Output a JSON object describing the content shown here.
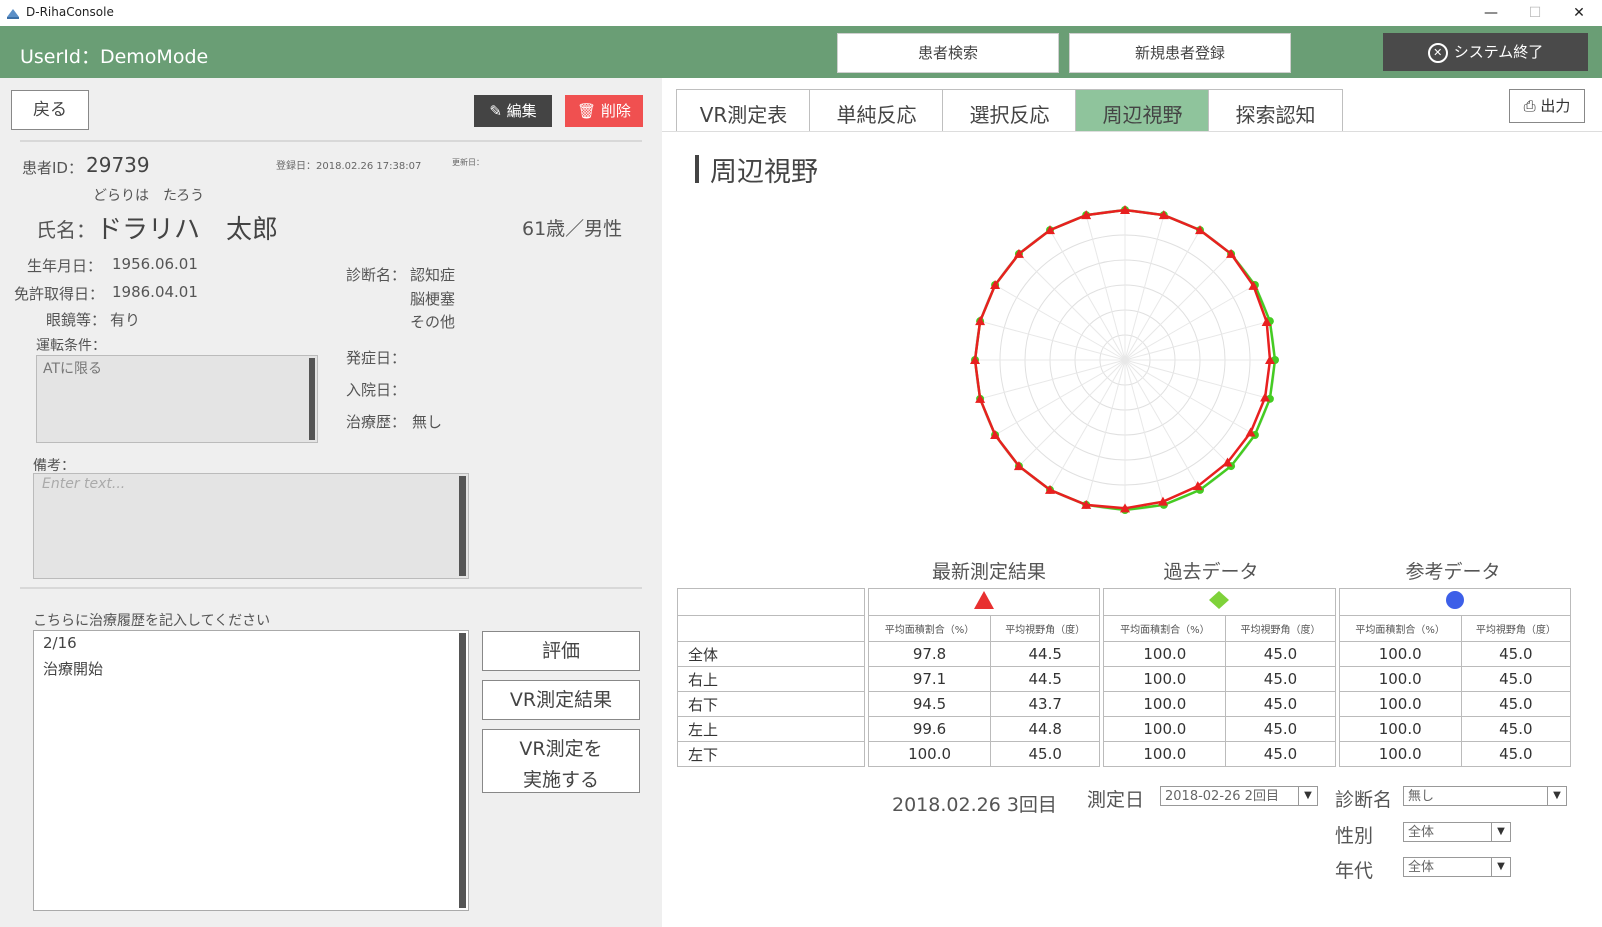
{
  "window": {
    "title": "D-RihaConsole",
    "minimize": "—",
    "maximize": "☐",
    "close": "✕"
  },
  "header": {
    "user_id": "UserId：DemoMode",
    "patient_search": "患者検索",
    "new_patient": "新規患者登録",
    "exit": "システム終了"
  },
  "left": {
    "back": "戻る",
    "edit": "編集",
    "delete": "削除",
    "patient_id_label": "患者ID：",
    "patient_id": "29739",
    "registered": "登録日：2018.02.26 17:38:07",
    "updated": "更新日：",
    "furigana": "どらりは　たろう",
    "name_label": "氏名：",
    "name": "ドラリハ　太郎",
    "age_sex": "61歳／男性",
    "birth_label": "生年月日：",
    "birth": "1956.06.01",
    "license_label": "免許取得日：",
    "license": "1986.04.01",
    "glasses_label": "眼鏡等：",
    "glasses": "有り",
    "driving_label": "運転条件：",
    "driving": "ATに限る",
    "diagnosis_label": "診断名：",
    "diagnoses": [
      "認知症",
      "脳梗塞",
      "その他"
    ],
    "onset_label": "発症日：",
    "admission_label": "入院日：",
    "treatment_label": "治療歴：",
    "treatment": "無し",
    "notes_label": "備考：",
    "notes_placeholder": "Enter text...",
    "history_label": "こちらに治療履歴を記入してください",
    "history_lines": [
      "2/16",
      "治療開始"
    ],
    "eval_button": "評価",
    "vr_result_button": "VR測定結果",
    "vr_run_line1": "VR測定を",
    "vr_run_line2": "実施する"
  },
  "tabs": [
    "VR測定表",
    "単純反応",
    "選択反応",
    "周辺視野",
    "探索認知"
  ],
  "active_tab": 3,
  "print": "出力",
  "section_title": "周辺視野",
  "chart_data": {
    "type": "radar",
    "num_axes": 24,
    "series": [
      {
        "name": "最新測定結果",
        "color": "#e82020",
        "marker": "triangle",
        "values": [
          45,
          45,
          45,
          45,
          44.5,
          44,
          43.5,
          43.5,
          43.5,
          43.5,
          43.7,
          44,
          44.5,
          45,
          45,
          45,
          45,
          45,
          45,
          45,
          45,
          45,
          45,
          45
        ]
      },
      {
        "name": "過去データ",
        "color": "#44cc22",
        "marker": "circle",
        "values": [
          45,
          45,
          45,
          45,
          45,
          45,
          45,
          45,
          45,
          45,
          45,
          45,
          45,
          45,
          45,
          45,
          45,
          45,
          45,
          45,
          45,
          45,
          45,
          45
        ]
      }
    ],
    "rmax": 45
  },
  "results": {
    "headers": [
      "最新測定結果",
      "過去データ",
      "参考データ"
    ],
    "marker_colors": [
      "#e83030",
      "#7fd23a",
      "#3d5fe8"
    ],
    "sub_headers": [
      "平均面積割合（%）",
      "平均視野角（度）"
    ],
    "rows": [
      {
        "label": "全体",
        "values": [
          "97.8",
          "44.5",
          "100.0",
          "45.0",
          "100.0",
          "45.0"
        ]
      },
      {
        "label": "右上",
        "values": [
          "97.1",
          "44.5",
          "100.0",
          "45.0",
          "100.0",
          "45.0"
        ]
      },
      {
        "label": "右下",
        "values": [
          "94.5",
          "43.7",
          "100.0",
          "45.0",
          "100.0",
          "45.0"
        ]
      },
      {
        "label": "左上",
        "values": [
          "99.6",
          "44.8",
          "100.0",
          "45.0",
          "100.0",
          "45.0"
        ]
      },
      {
        "label": "左下",
        "values": [
          "100.0",
          "45.0",
          "100.0",
          "45.0",
          "100.0",
          "45.0"
        ]
      }
    ]
  },
  "filters": {
    "current_measure": "2018.02.26 3回目",
    "measure_date_label": "測定日",
    "measure_date_value": "2018-02-26 2回目",
    "diagnosis_label": "診断名",
    "diagnosis_value": "無し",
    "sex_label": "性別",
    "sex_value": "全体",
    "age_label": "年代",
    "age_value": "全体"
  }
}
